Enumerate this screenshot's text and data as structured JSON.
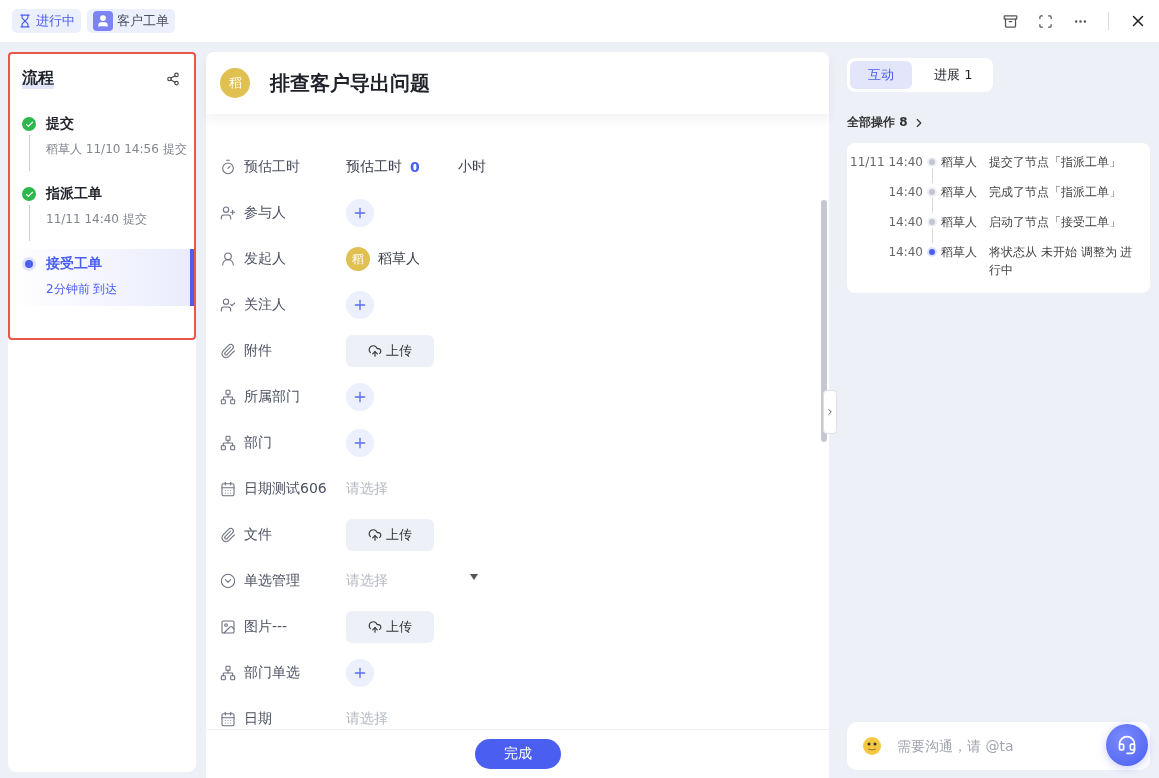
{
  "top_bar": {
    "status": "进行中",
    "type": "客户工单"
  },
  "flow": {
    "title": "流程",
    "steps": [
      {
        "name": "提交",
        "note": "稻草人 11/10 14:56 提交",
        "done": true,
        "selected": false
      },
      {
        "name": "指派工单",
        "note": "11/11 14:40 提交",
        "done": true,
        "selected": false
      },
      {
        "name": "接受工单",
        "note": "2分钟前 到达",
        "done": false,
        "selected": true
      }
    ]
  },
  "task": {
    "avatar": "稻",
    "title": "排查客户导出问题",
    "fields": [
      {
        "label": "预估工时",
        "kind": "hours",
        "value_label": "预估工时",
        "value": "0",
        "unit": "小时"
      },
      {
        "label": "参与人",
        "kind": "add"
      },
      {
        "label": "发起人",
        "kind": "person",
        "avatar": "稻",
        "value": "稻草人"
      },
      {
        "label": "关注人",
        "kind": "add"
      },
      {
        "label": "附件",
        "kind": "upload",
        "value": "上传"
      },
      {
        "label": "所属部门",
        "kind": "add"
      },
      {
        "label": "部门",
        "kind": "add"
      },
      {
        "label": "日期测试606",
        "kind": "select",
        "placeholder": "请选择"
      },
      {
        "label": "文件",
        "kind": "upload",
        "value": "上传"
      },
      {
        "label": "单选管理",
        "kind": "dropdown",
        "placeholder": "请选择"
      },
      {
        "label": "图片---",
        "kind": "upload",
        "value": "上传"
      },
      {
        "label": "部门单选",
        "kind": "add"
      },
      {
        "label": "日期",
        "kind": "select",
        "placeholder": "请选择"
      }
    ],
    "done_button": "完成"
  },
  "activity": {
    "tabs": [
      {
        "label": "互动",
        "selected": true
      },
      {
        "label": "进展 1",
        "selected": false
      }
    ],
    "all_ops": "全部操作 8",
    "log": [
      {
        "time": "11/11 14:40",
        "user": "稻草人",
        "text": "提交了节点「指派工单」",
        "active": false
      },
      {
        "time": "14:40",
        "user": "稻草人",
        "text": "完成了节点「指派工单」",
        "active": false
      },
      {
        "time": "14:40",
        "user": "稻草人",
        "text": "启动了节点「接受工单」",
        "active": false
      },
      {
        "time": "14:40",
        "user": "稻草人",
        "text": "将状态从 未开始 调整为 进行中",
        "active": true
      }
    ],
    "comment": {
      "placeholder": "需要沟通，请 @ta"
    }
  }
}
